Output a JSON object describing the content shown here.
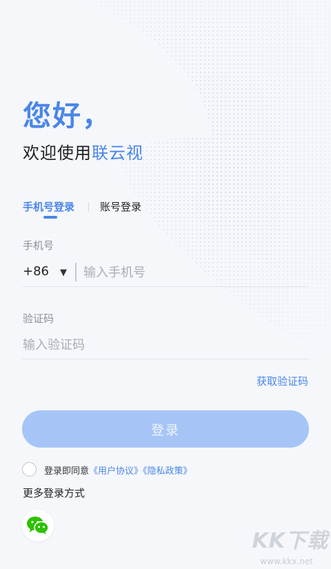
{
  "greeting": {
    "hello": "您好，",
    "welcome_prefix": "欢迎使用",
    "brand": "联云视"
  },
  "tabs": {
    "phone_login": "手机号登录",
    "account_login": "账号登录"
  },
  "phone": {
    "label": "手机号",
    "country_code": "+86",
    "caret": "▼",
    "placeholder": "输入手机号"
  },
  "code": {
    "label": "验证码",
    "placeholder": "输入验证码",
    "get_code": "获取验证码"
  },
  "login": {
    "button_label": "登录"
  },
  "agreement": {
    "prefix": "登录即同意",
    "user_agreement": "《用户协议》",
    "privacy_policy": "《隐私政策》"
  },
  "more_login": {
    "title": "更多登录方式"
  },
  "watermark": {
    "logo": "KK下载",
    "url": "www.kkx.net"
  },
  "colors": {
    "accent": "#4a86e8",
    "button": "#a6c5f6",
    "background": "#f5f7fb"
  },
  "icons": {
    "wechat": "wechat-icon",
    "dropdown": "chevron-down-icon"
  }
}
